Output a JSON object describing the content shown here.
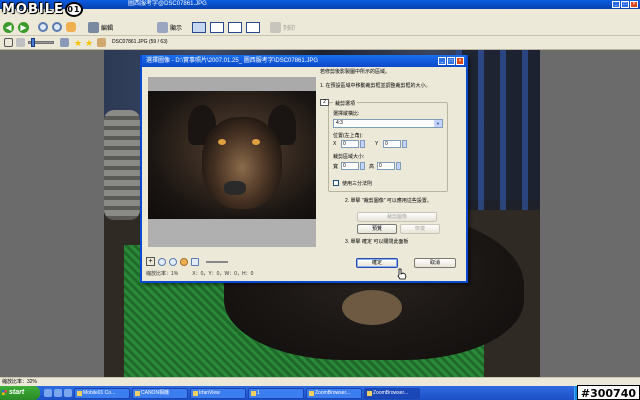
{
  "watermark_logo": {
    "text": "MOBILE",
    "badge": "01"
  },
  "window": {
    "title": "圖西服考字@DSC07861.JPG"
  },
  "toolbar": {
    "edit_label": "編輯",
    "display_label": "顯示",
    "print_label": "列印",
    "file_info": "DSC07861.JPG (59 / 63)"
  },
  "dialog": {
    "title": "選擇圖像 - D:\\實事照片\\2007.01.25_ 圖西服考字\\DSC07861.JPG",
    "instruction": "若修剪後影製圖中所示的區域。",
    "step1": "1. 在預設區域中移動裁剪框並調整裁剪框的大小。",
    "group_title": "裁剪選項",
    "group_badge": "2",
    "ratio_label": "選擇縱橫比:",
    "ratio_value": "4:3",
    "position_label": "位置(左上角):",
    "x_label": "X",
    "x_value": "0",
    "y_label": "Y",
    "y_value": "0",
    "size_label": "裁剪區域大小:",
    "w_label": "寬",
    "w_value": "0",
    "h_label": "高",
    "h_value": "0",
    "rule_label": "使用三分法則",
    "step2": "2. 單擊 \"裁剪圖像\" 可以應用這些設置。",
    "crop_button": "裁剪圖像",
    "preview_button": "預覽",
    "restore_button": "恢復",
    "step3": "3. 單擊 確定 可以關閉此面板",
    "ok_button": "確定",
    "cancel_button": "取消",
    "status_zoom": "縮放比率：1%",
    "status_coords": "X：0，Y：0，W：0，H：0"
  },
  "statusbar": {
    "text": "縮放比率：32%"
  },
  "taskbar": {
    "start": "start",
    "tasks": [
      "Mobile01 Co...",
      "CANON相機",
      "IrfanView",
      "1",
      "ZoomBrowser...",
      "ZoomBrowser..."
    ]
  },
  "corner_watermark": "#300740"
}
